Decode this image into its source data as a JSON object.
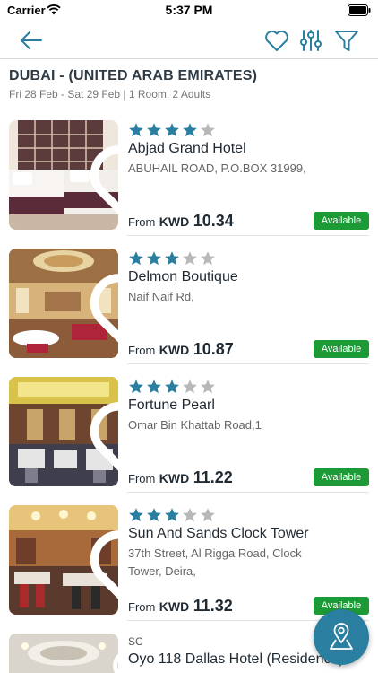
{
  "status_bar": {
    "carrier": "Carrier",
    "time": "5:37 PM"
  },
  "nav": {
    "icons": [
      "back-arrow-icon",
      "heart-icon",
      "sliders-icon",
      "filter-funnel-icon"
    ],
    "accent_color": "#2a7fa0"
  },
  "search": {
    "destination": "DUBAI - (UNITED ARAB EMIRATES)",
    "summary": "Fri 28 Feb - Sat 29 Feb | 1 Room, 2 Adults"
  },
  "price_prefix": "From",
  "currency": "KWD",
  "availability_color": "#1b9a36",
  "star_filled_color": "#2a7fa0",
  "star_empty_color": "#b8b8b8",
  "hotels": [
    {
      "name": "Abjad Grand Hotel",
      "address": "ABUHAIL ROAD, P.O.BOX 31999,",
      "stars": 4,
      "price": "10.34",
      "status": "Available"
    },
    {
      "name": "Delmon Boutique",
      "address": "Naif Naif Rd,",
      "stars": 3,
      "price": "10.87",
      "status": "Available"
    },
    {
      "name": "Fortune Pearl",
      "address": "Omar Bin Khattab Road,1",
      "stars": 3,
      "price": "11.22",
      "status": "Available"
    },
    {
      "name": "Sun And Sands Clock Tower",
      "address": "37th Street, Al Rigga Road, Clock Tower, Deira,",
      "stars": 3,
      "price": "11.32",
      "status": "Available"
    }
  ],
  "partial_hotel": {
    "tag": "SC",
    "name": "Oyo 118 Dallas Hotel (Residence)"
  }
}
